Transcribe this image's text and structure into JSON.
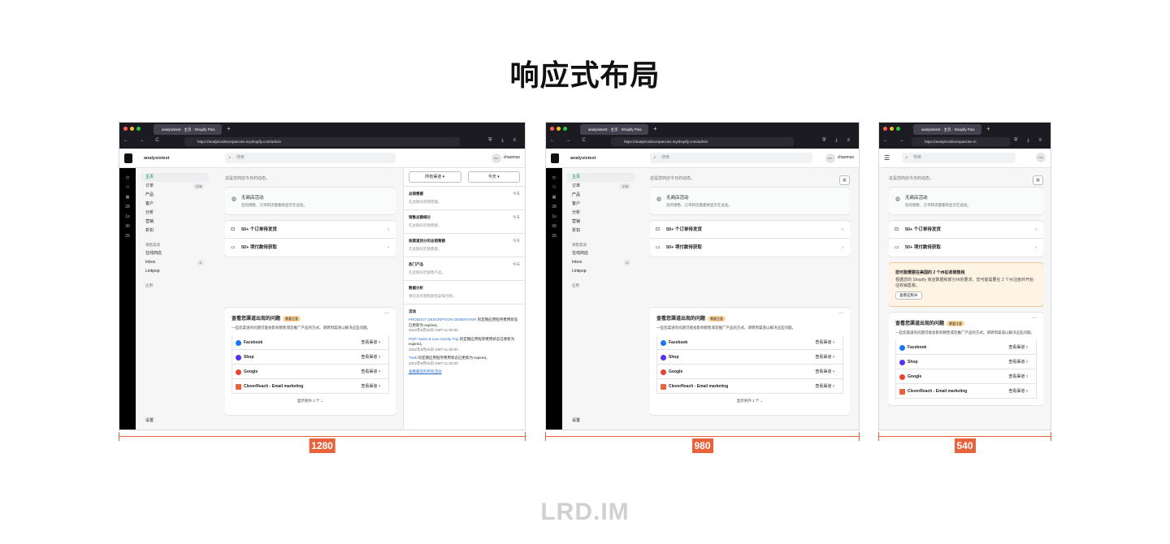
{
  "heading": "响应式布局",
  "footer": "LRD.IM",
  "browser": {
    "tab_title": "analysistest · 主页 · Shopify Plus",
    "url_full": "https://analyticsdiscrepancies.myshopify.com/admin",
    "url_short": "https://analyticsdiscrepancies.m",
    "nav_icons": "← → C",
    "right_icons": "⛨ ⤓ ≡"
  },
  "admin": {
    "store_name": "analysistest",
    "search_placeholder": "搜索",
    "user_initials": "mc",
    "user_name": "chaomax",
    "nav": [
      {
        "label": "主页"
      },
      {
        "label": "订单",
        "count": "176"
      },
      {
        "label": "产品"
      },
      {
        "label": "客户"
      },
      {
        "label": "分析"
      },
      {
        "label": "营销"
      },
      {
        "label": "折扣"
      }
    ],
    "sales_channels_label": "销售渠道",
    "channels_nav": [
      {
        "label": "在线商店"
      },
      {
        "label": "Inbox",
        "count": "1"
      },
      {
        "label": "Linkpop"
      }
    ],
    "apps_label": "应用",
    "settings_label": "设置",
    "rail_numbers": [
      "28",
      "1s",
      "30",
      "25"
    ],
    "hint": "这是您商店今日的动态。",
    "empty_title": "无商店活动",
    "empty_desc": "您的销售、订单和流量都将显示在此处。",
    "tasks": [
      {
        "label": "50+ 个订单待发货"
      },
      {
        "label": "50+ 项付款待获取"
      }
    ],
    "tax": {
      "title": "您可能需要在美国的 2 个州征收销售税",
      "desc": "根据您的 Shopify 商店数据和部分州的要求，您可能需要在 2 个州注册并开始征收销售税。",
      "button": "查看征税州"
    },
    "issues": {
      "title": "查看您渠道出现的问题",
      "badge": "需要注意",
      "desc": "一些您渠道的问题可能会影响销售或您推广产品的方式。请转到渠道以解决这些问题。",
      "view_label": "查看渠道",
      "channels": [
        {
          "name": "Facebook",
          "color": "#1877f2"
        },
        {
          "name": "Shop",
          "color": "#5a31f4"
        },
        {
          "name": "Google",
          "color": "#ea4335"
        },
        {
          "name": "CleverReach - Email marketing",
          "color": "#e8623c"
        }
      ],
      "more": "显示另外 1 个"
    },
    "sidebar": {
      "channel_select": "所有渠道",
      "date_select": "今天",
      "metrics": [
        {
          "title": "总销售额",
          "tag": "今天",
          "desc": "在此期间无销售额。"
        },
        {
          "title": "销售总额细分",
          "tag": "今天",
          "desc": "在此期间无销售额。"
        },
        {
          "title": "按渠道划分的总销售额",
          "tag": "今天",
          "desc": "在此期间无销售额。"
        },
        {
          "title": "热门产品",
          "tag": "今天",
          "desc": "在此期间无销售产品。"
        },
        {
          "title": "数据分析",
          "tag": "",
          "desc": "将在您有销售额后安排付款。"
        }
      ],
      "activity_title": "活动",
      "activity": [
        {
          "link": "PRODUCT DESCRIPTION GENERATOR",
          "text": " 的定期应用程序费用状态已更新为 expired。",
          "date": "2022年9月25日 GMT-11:00:00"
        },
        {
          "link": "POP! Sales & Live Activity Pop",
          "text": " 的定期应用程序费用状态已更新为 expired。",
          "date": "2022年9月25日 GMT-11:00:00"
        },
        {
          "link": "Tiwik",
          "text": " 的定期应用程序费用状态已更新为 expired。",
          "date": "2022年9月25日 GMT-11:00:00"
        }
      ],
      "view_all": "查看最近的所有活动"
    }
  },
  "dimensions": [
    "1280",
    "980",
    "540"
  ],
  "colors": {
    "accent": "#e8623c",
    "green": "#008060",
    "warning_bg": "#fff4e4"
  }
}
